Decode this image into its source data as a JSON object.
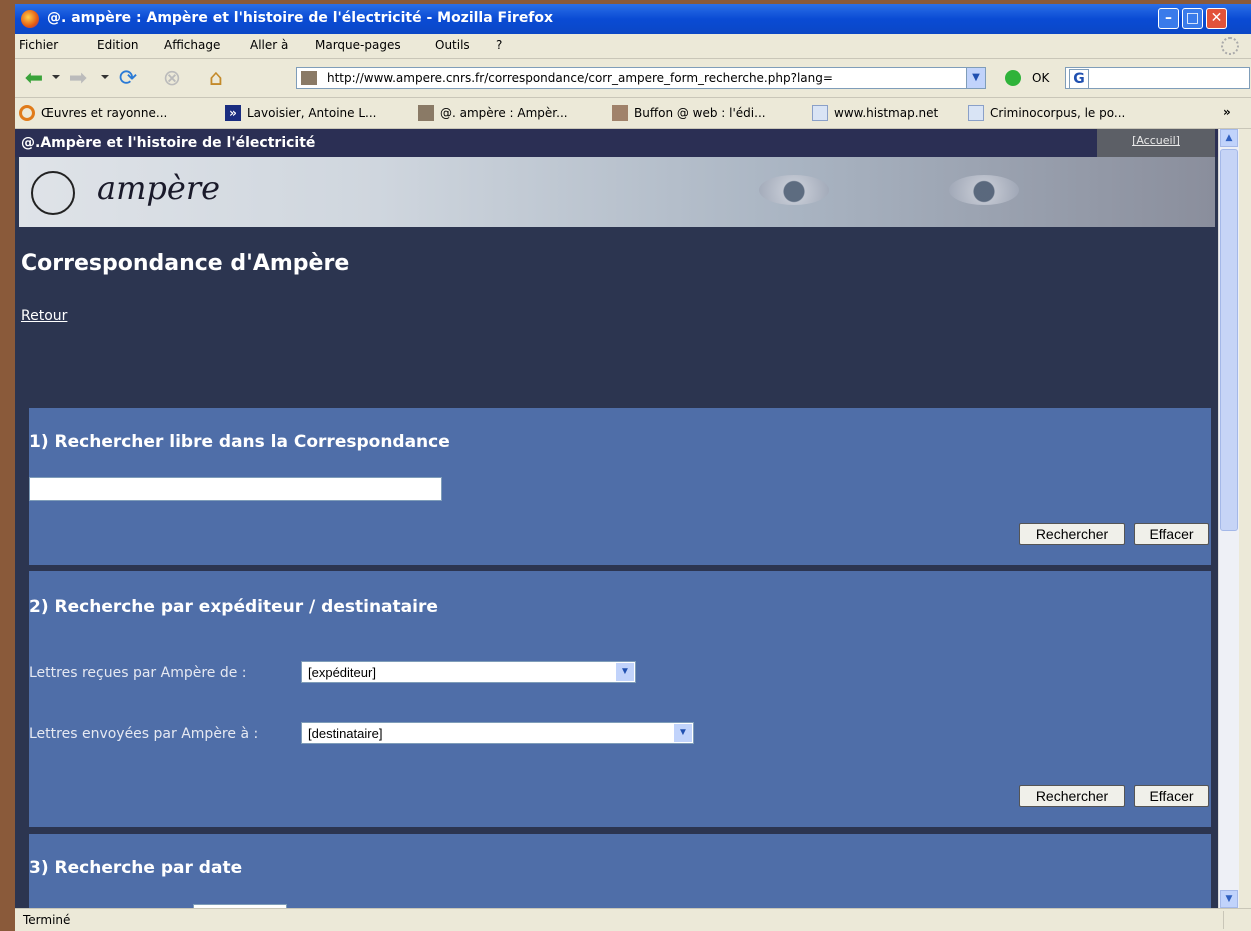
{
  "window": {
    "title": "@. ampère : Ampère et l'histoire de l'électricité - Mozilla Firefox"
  },
  "menu": [
    "Fichier",
    "Edition",
    "Affichage",
    "Aller à",
    "Marque-pages",
    "Outils",
    "?"
  ],
  "nav": {
    "url": "http://www.ampere.cnrs.fr/correspondance/corr_ampere_form_recherche.php?lang=",
    "go_label": "OK",
    "search_engine": "G"
  },
  "bookmarks": [
    {
      "label": "Œuvres et rayonne...",
      "icon": "circle-orange-icon",
      "color": "#e07b1a"
    },
    {
      "label": "Lavoisier, Antoine L...",
      "icon": "chevron-double-icon",
      "color": "#1a2d80"
    },
    {
      "label": "@. ampère : Ampèr...",
      "icon": "portrait-icon",
      "color": "#8a7a66"
    },
    {
      "label": "Buffon @ web : l'édi...",
      "icon": "portrait-icon",
      "color": "#a0826a"
    },
    {
      "label": "www.histmap.net",
      "icon": "page-icon",
      "color": "#d9e4f5"
    },
    {
      "label": "Criminocorpus, le po...",
      "icon": "page-icon",
      "color": "#d9e4f5"
    }
  ],
  "bookmarks_overflow": "»",
  "site": {
    "title": "@.Ampère et l'histoire de l'électricité",
    "accueil": "[Accueil]",
    "signature": "ampère",
    "page_title": "Correspondance d'Ampère",
    "back_link": "Retour"
  },
  "section1": {
    "heading": "1) Rechercher libre dans la Correspondance",
    "search_value": "",
    "search_button": "Rechercher",
    "clear_button": "Effacer"
  },
  "section2": {
    "heading": "2) Recherche par expéditeur / destinataire",
    "received_label": "Lettres reçues par Ampère de :",
    "received_value": "[expéditeur]",
    "sent_label": "Lettres envoyées par Ampère à :",
    "sent_value": "[destinataire]",
    "search_button": "Rechercher",
    "clear_button": "Effacer"
  },
  "section3": {
    "heading": "3) Recherche par date"
  },
  "status": "Terminé",
  "colors": {
    "panel": "#4f6ea8",
    "page_bg": "#2c3550",
    "header_bg": "#2b2f54"
  }
}
